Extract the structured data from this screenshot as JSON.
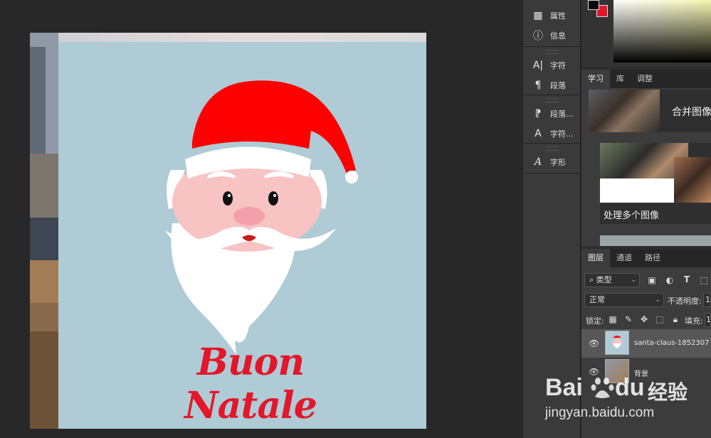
{
  "dock": {
    "items": [
      {
        "label": "属性",
        "icon": "properties-icon"
      },
      {
        "label": "信息",
        "icon": "info-icon"
      },
      {
        "label": "字符",
        "icon": "character-icon"
      },
      {
        "label": "段落",
        "icon": "paragraph-icon"
      },
      {
        "label": "段落...",
        "icon": "paragraph-styles-icon"
      },
      {
        "label": "字符...",
        "icon": "character-styles-icon"
      },
      {
        "label": "字形",
        "icon": "glyphs-icon"
      }
    ]
  },
  "color": {
    "foreground": "#0a0a0a",
    "background": "#e3172b"
  },
  "learn_tabs": [
    "学习",
    "库",
    "调整"
  ],
  "learn": {
    "card1_title": "合并图像",
    "card2_title": "处理多个图像"
  },
  "layers_tabs": [
    "图层",
    "通道",
    "路径"
  ],
  "layers": {
    "filter_label": "类型",
    "blend_mode": "正常",
    "opacity_label": "不透明度:",
    "opacity_value": "1",
    "lock_label": "锁定:",
    "fill_label": "填充:",
    "fill_value": "1",
    "rows": [
      {
        "name": "santa-claus-1852307"
      },
      {
        "name": "背景"
      }
    ]
  },
  "artwork": {
    "greeting": "Buon Natale"
  },
  "watermark": {
    "brand": "Bai",
    "brand2": "du",
    "tagline": "经验",
    "url": "jingyan.baidu.com"
  }
}
